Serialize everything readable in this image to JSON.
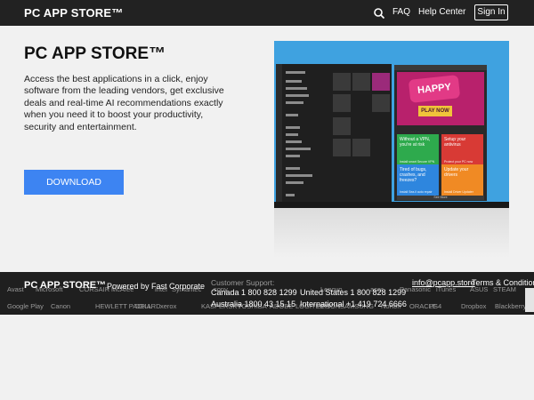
{
  "header": {
    "logo": "PC APP STORE™",
    "search_icon": "search-icon",
    "nav": {
      "faq": "FAQ",
      "help": "Help Center"
    },
    "signin": "Sign In"
  },
  "hero": {
    "title": "PC APP STORE™",
    "description": "Access the best applications in a click, enjoy software from the leading vendors, get exclusive deals and real-time AI recommendations exactly when you need it to boost your productivity, security and entertainment.",
    "download": "DOWNLOAD"
  },
  "screenshot": {
    "banner_title": "HAPPY",
    "banner_cta": "PLAY NOW",
    "cards": [
      {
        "title": "Without a VPN, you're at risk",
        "foot": "Install smart Secure VPN",
        "color": "#2eaa4d"
      },
      {
        "title": "Setup your antivirus",
        "foot": "Protect your PC now",
        "color": "#d83a35"
      },
      {
        "title": "Tired of bugs, crashes, and freezes?",
        "foot": "Install Sea.il auto repair",
        "color": "#2e86de"
      },
      {
        "title": "Update your drivers",
        "foot": "Install Driver Updater",
        "color": "#f08a24"
      }
    ],
    "more": "See More"
  },
  "footer": {
    "brand": "PC APP STORE™",
    "powered": "Powered by Fast Corporate",
    "support_label": "Customer Support:",
    "canada": "Canada 1 800 828 1299",
    "us": "United States 1 800 828 1299",
    "australia": "Australia 1800 43 15 15",
    "international": "International +1 419 724 6666",
    "email": "info@pcapp.store",
    "terms": "Terms & Conditions",
    "logos_row1": [
      "Avast",
      "Microsoft",
      "CORSAIR",
      "McAfee",
      "intel",
      "Symantec",
      "sony",
      "Lenovo",
      "acer",
      "Panasonic",
      "iTunes",
      "ASUS",
      "STEAM"
    ],
    "logos_row2": [
      "Google Play",
      "Canon",
      "HEWLETT PACKARD",
      "DELL",
      "xerox",
      "KASPERSKY",
      "TOSHIBA",
      "ADOBE",
      "LOGITECH",
      "EPSON",
      "SAMSUNG",
      "Norton",
      "ORACLE",
      "PS4",
      "Dropbox",
      "Blackberry"
    ]
  }
}
